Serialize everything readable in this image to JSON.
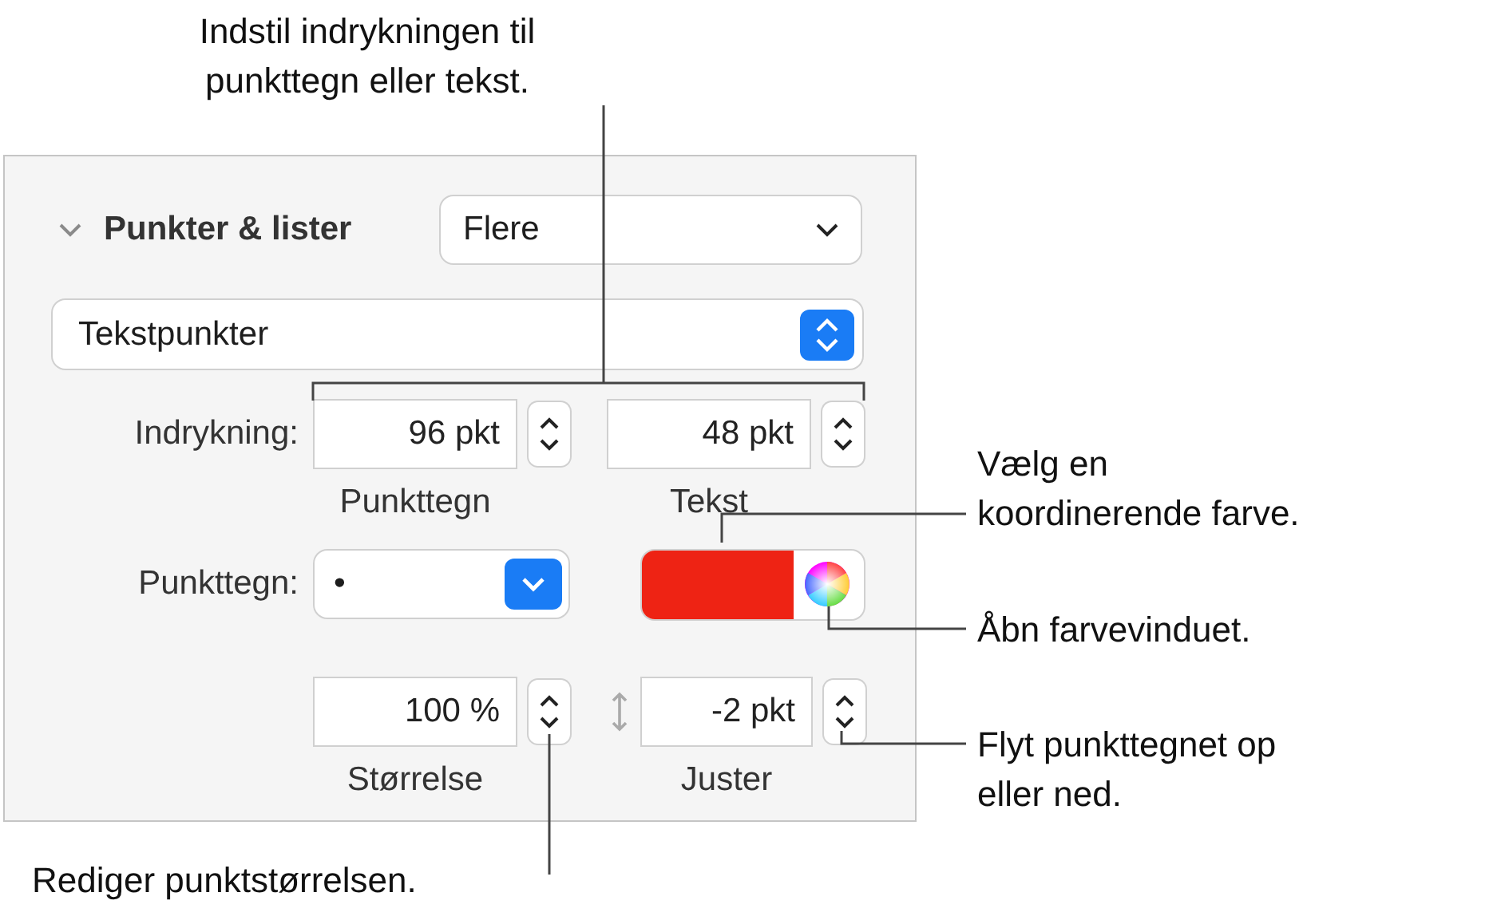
{
  "panel": {
    "section": {
      "title": "Punkter & lister",
      "expanded": true,
      "style_value": "Flere"
    },
    "bullet_type": "Tekstpunkter",
    "indent": {
      "label": "Indrykning:",
      "fields": [
        {
          "value": "96 pkt",
          "caption": "Punkttegn"
        },
        {
          "value": "48 pkt",
          "caption": "Tekst"
        }
      ]
    },
    "bullet": {
      "label": "Punkttegn:",
      "value": "•",
      "color": "#ee2314"
    },
    "size": {
      "value": "100 %",
      "caption": "Størrelse"
    },
    "align": {
      "value": "-2 pkt",
      "caption": "Juster"
    }
  },
  "callouts": [
    {
      "text": "Indstil indrykningen til punkttegn eller tekst."
    },
    {
      "text": "Vælg en koordinerende farve."
    },
    {
      "text": "Åbn farvevinduet."
    },
    {
      "text": "Flyt punkttegnet op eller ned."
    },
    {
      "text": "Rediger punktstørrelsen."
    }
  ]
}
